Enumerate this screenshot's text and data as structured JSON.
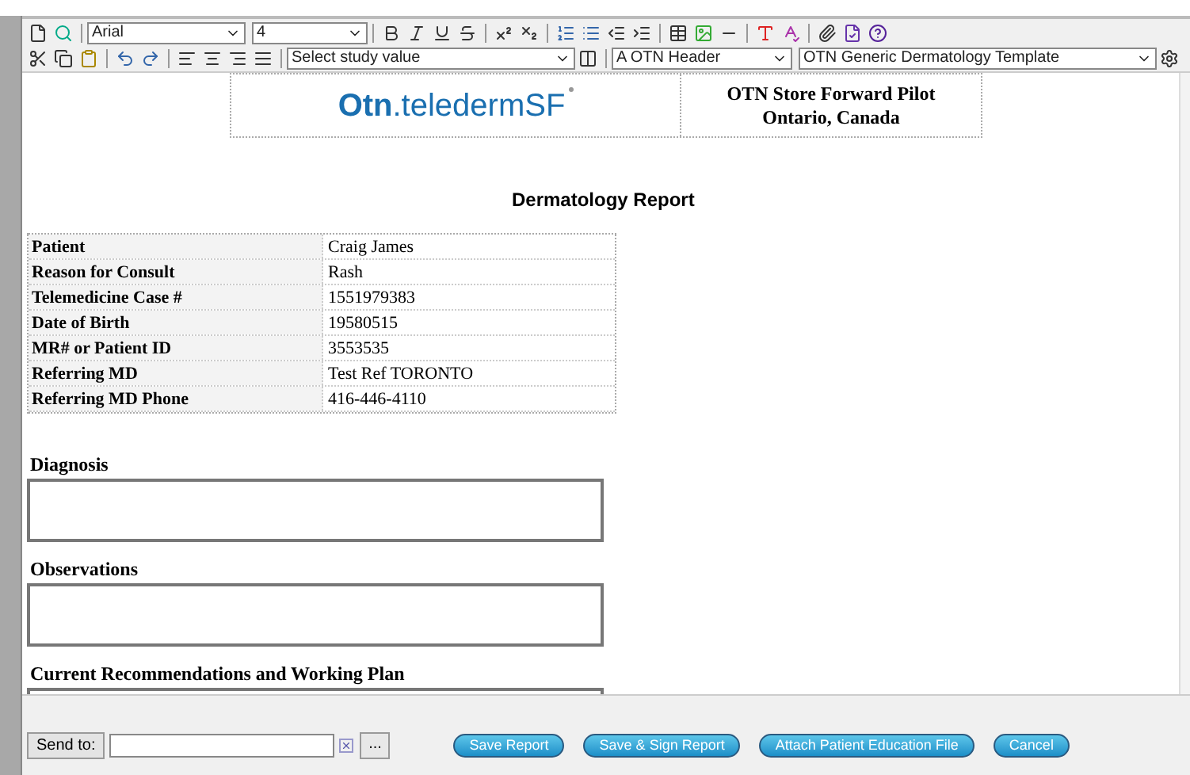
{
  "toolbar": {
    "font": "Arial",
    "size": "4",
    "study_value": "Select study value",
    "header": "A OTN Header",
    "template": "OTN Generic Dermatology Template"
  },
  "header": {
    "logo_brand": "Otn",
    "logo_product": ".teledermSF",
    "title": "OTN Store Forward Pilot",
    "subtitle": "Ontario, Canada"
  },
  "report_title": "Dermatology Report",
  "patient_table": [
    {
      "label": "Patient",
      "value": "Craig James"
    },
    {
      "label": "Reason for Consult",
      "value": "Rash"
    },
    {
      "label": "Telemedicine Case #",
      "value": "1551979383"
    },
    {
      "label": "Date of Birth",
      "value": "19580515"
    },
    {
      "label": "MR# or Patient ID",
      "value": "3553535"
    },
    {
      "label": "Referring MD",
      "value": "Test Ref TORONTO"
    },
    {
      "label": "Referring MD Phone",
      "value": "416-446-4110"
    }
  ],
  "sections": [
    {
      "heading": "Diagnosis"
    },
    {
      "heading": "Observations"
    },
    {
      "heading": "Current Recommendations and Working Plan"
    }
  ],
  "footer": {
    "send_to_label": "Send to:",
    "browse": "...",
    "buttons": [
      "Save Report",
      "Save & Sign Report",
      "Attach Patient Education File",
      "Cancel"
    ]
  }
}
